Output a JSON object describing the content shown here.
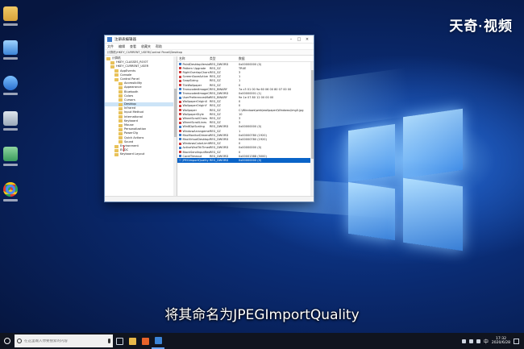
{
  "brand": {
    "text": "天奇·视频"
  },
  "subtitle": {
    "text": "将其命名为JPEGImportQuality"
  },
  "regedit": {
    "title": "注册表编辑器",
    "menu": [
      "文件",
      "编辑",
      "查看",
      "收藏夹",
      "帮助"
    ],
    "address": "计算机\\HKEY_CURRENT_USER\\Control Panel\\Desktop",
    "tree": [
      {
        "label": "计算机",
        "indent": 0
      },
      {
        "label": "HKEY_CLASSES_ROOT",
        "indent": 1
      },
      {
        "label": "HKEY_CURRENT_USER",
        "indent": 1
      },
      {
        "label": "AppEvents",
        "indent": 2
      },
      {
        "label": "Console",
        "indent": 2
      },
      {
        "label": "Control Panel",
        "indent": 2
      },
      {
        "label": "Accessibility",
        "indent": 3
      },
      {
        "label": "Appearance",
        "indent": 3
      },
      {
        "label": "Bluetooth",
        "indent": 3
      },
      {
        "label": "Colors",
        "indent": 3
      },
      {
        "label": "Cursors",
        "indent": 3
      },
      {
        "label": "Desktop",
        "indent": 3,
        "selected": true
      },
      {
        "label": "Infrared",
        "indent": 3
      },
      {
        "label": "Input Method",
        "indent": 3
      },
      {
        "label": "International",
        "indent": 3
      },
      {
        "label": "Keyboard",
        "indent": 3
      },
      {
        "label": "Mouse",
        "indent": 3
      },
      {
        "label": "Personalization",
        "indent": 3
      },
      {
        "label": "PowerCfg",
        "indent": 3
      },
      {
        "label": "Quick Actions",
        "indent": 3
      },
      {
        "label": "Sound",
        "indent": 3
      },
      {
        "label": "Environment",
        "indent": 2
      },
      {
        "label": "EUDC",
        "indent": 2
      },
      {
        "label": "Keyboard Layout",
        "indent": 2
      }
    ],
    "headers": {
      "name": "名称",
      "type": "类型",
      "data": "数据"
    },
    "values": [
      {
        "name": "PaintDesktopVersion",
        "type": "REG_DWORD",
        "data": "0x00000000 (0)",
        "kind": "dw"
      },
      {
        "name": "Pattern Upgrade",
        "type": "REG_SZ",
        "data": "TRUE",
        "kind": "sz"
      },
      {
        "name": "RightOverlapChars",
        "type": "REG_SZ",
        "data": "3",
        "kind": "sz"
      },
      {
        "name": "ScreenSaveActive",
        "type": "REG_SZ",
        "data": "1",
        "kind": "sz"
      },
      {
        "name": "SnapSizing",
        "type": "REG_SZ",
        "data": "1",
        "kind": "sz"
      },
      {
        "name": "TileWallpaper",
        "type": "REG_SZ",
        "data": "0",
        "kind": "sz"
      },
      {
        "name": "TranscodedImageCache",
        "type": "REG_BINARY",
        "data": "7a c3 01 00 9a 60 06 00 80 07 00 00",
        "kind": "dw"
      },
      {
        "name": "TranscodedImageCount",
        "type": "REG_DWORD",
        "data": "0x00000001 (1)",
        "kind": "dw"
      },
      {
        "name": "UserPreferencesMask",
        "type": "REG_BINARY",
        "data": "9e 1e 07 80 12 00 00 00",
        "kind": "dw"
      },
      {
        "name": "WallpaperOriginX",
        "type": "REG_SZ",
        "data": "0",
        "kind": "sz"
      },
      {
        "name": "WallpaperOriginY",
        "type": "REG_SZ",
        "data": "0",
        "kind": "sz"
      },
      {
        "name": "Wallpaper",
        "type": "REG_SZ",
        "data": "C:\\Windows\\web\\wallpaper\\Windows\\img0.jpg",
        "kind": "sz"
      },
      {
        "name": "WallpaperStyle",
        "type": "REG_SZ",
        "data": "10",
        "kind": "sz"
      },
      {
        "name": "WheelScrollChars",
        "type": "REG_SZ",
        "data": "3",
        "kind": "sz"
      },
      {
        "name": "WheelScrollLines",
        "type": "REG_SZ",
        "data": "3",
        "kind": "sz"
      },
      {
        "name": "Win8DpiScaling",
        "type": "REG_DWORD",
        "data": "0x00000000 (0)",
        "kind": "dw"
      },
      {
        "name": "WindowArrangementActive",
        "type": "REG_SZ",
        "data": "1",
        "kind": "sz"
      },
      {
        "name": "MaxMonitorDimension",
        "type": "REG_DWORD",
        "data": "0x00000780 (1920)",
        "kind": "dw"
      },
      {
        "name": "MaxVirtualDesktopDimension",
        "type": "REG_DWORD",
        "data": "0x00000780 (1920)",
        "kind": "dw"
      },
      {
        "name": "WindowsColorLimit",
        "type": "REG_SZ",
        "data": "0",
        "kind": "sz"
      },
      {
        "name": "ActiveWndTrkTimeout",
        "type": "REG_DWORD",
        "data": "0x00000000 (0)",
        "kind": "dw"
      },
      {
        "name": "BlockSendInputResets",
        "type": "REG_SZ",
        "data": "0",
        "kind": "sz"
      },
      {
        "name": "CaretTimeout",
        "type": "REG_DWORD",
        "data": "0x00001388 (5000)",
        "kind": "dw"
      },
      {
        "name": "JPEGImportQuality",
        "type": "REG_DWORD",
        "data": "0x00000000 (0)",
        "kind": "dw",
        "selected": true
      }
    ]
  },
  "taskbar": {
    "search_placeholder": "在这里输入你要搜索的内容",
    "lang": "中",
    "time": "17:32",
    "date": "2020/6/28"
  },
  "colors": {
    "accent": "#0a64c8",
    "selection": "#cce4f7"
  }
}
